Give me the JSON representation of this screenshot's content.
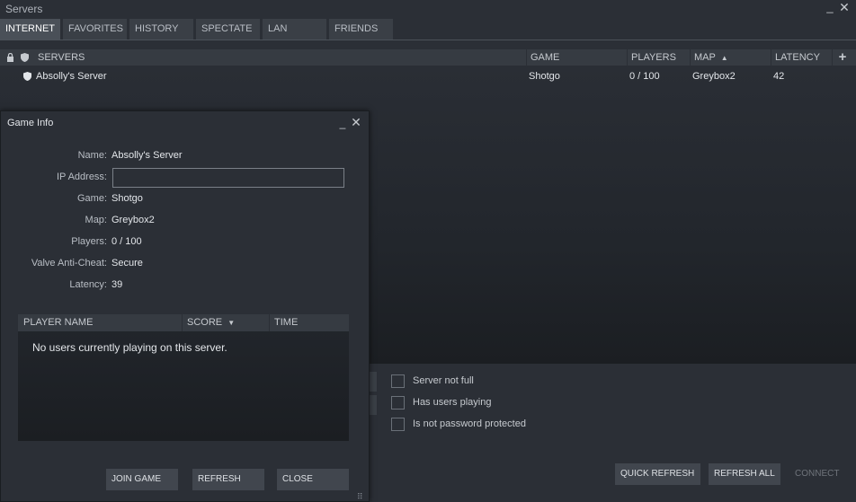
{
  "window": {
    "title": "Servers",
    "min_glyph": "_",
    "close_glyph": "✕"
  },
  "tabs": [
    {
      "label": "INTERNET",
      "active": true
    },
    {
      "label": "FAVORITES"
    },
    {
      "label": "HISTORY"
    },
    {
      "label": "SPECTATE"
    },
    {
      "label": "LAN"
    },
    {
      "label": "FRIENDS"
    }
  ],
  "list": {
    "columns": {
      "servers": "SERVERS",
      "game": "GAME",
      "players": "PLAYERS",
      "map": "MAP",
      "map_sort_glyph": "▲",
      "latency": "LATENCY",
      "add_glyph": "+"
    },
    "rows": [
      {
        "name": "Absolly's Server",
        "game": "Shotgo",
        "players": "0 / 100",
        "map": "Greybox2",
        "latency": "42"
      }
    ]
  },
  "filters": [
    {
      "label": "Server not full",
      "checked": false
    },
    {
      "label": "Has users playing",
      "checked": false
    },
    {
      "label": "Is not password protected",
      "checked": false
    }
  ],
  "footer_buttons": {
    "quick_refresh": "QUICK REFRESH",
    "refresh_all": "REFRESH ALL",
    "connect": "CONNECT"
  },
  "game_info": {
    "title": "Game Info",
    "min_glyph": "_",
    "close_glyph": "✕",
    "fields": {
      "name_label": "Name:",
      "name_value": "Absolly's Server",
      "ip_label": "IP Address:",
      "ip_value": "",
      "game_label": "Game:",
      "game_value": "Shotgo",
      "map_label": "Map:",
      "map_value": "Greybox2",
      "players_label": "Players:",
      "players_value": "0 / 100",
      "vac_label": "Valve Anti-Cheat:",
      "vac_value": "Secure",
      "latency_label": "Latency:",
      "latency_value": "39"
    },
    "player_table": {
      "col_name": "PLAYER NAME",
      "col_score": "SCORE",
      "score_sort_glyph": "▼",
      "col_time": "TIME",
      "empty_message": "No users currently playing on this server."
    },
    "buttons": {
      "join": "JOIN GAME",
      "refresh": "REFRESH",
      "close": "CLOSE"
    },
    "grip_glyph": "⠿"
  },
  "colors": {
    "background": "#2b2f36",
    "tab_active": "#4a5058",
    "header": "#363b42",
    "button": "#41464e"
  }
}
